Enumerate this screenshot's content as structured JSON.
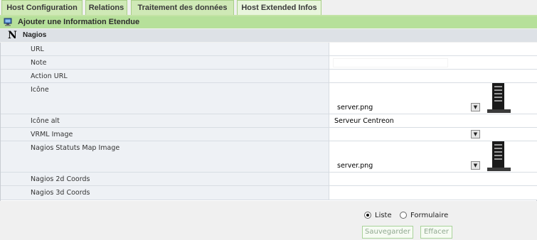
{
  "tabs": [
    {
      "label": "Host Configuration"
    },
    {
      "label": "Relations"
    },
    {
      "label": "Traitement des données"
    },
    {
      "label": "Host Extended Infos"
    }
  ],
  "section": {
    "title": "Ajouter une Information Etendue",
    "icon": "computer-icon"
  },
  "group": {
    "label": "Nagios",
    "icon": "nagios-n-icon"
  },
  "fields": {
    "url": {
      "label": "URL",
      "value": ""
    },
    "note": {
      "label": "Note",
      "value": ""
    },
    "action_url": {
      "label": "Action URL",
      "value": ""
    },
    "icone": {
      "label": "Icône",
      "selected": "server.png",
      "preview_icon": "server-tower-icon"
    },
    "icone_alt": {
      "label": "Icône alt",
      "value": "Serveur Centreon"
    },
    "vrml_image": {
      "label": "VRML Image",
      "selected": ""
    },
    "statuts_map_image": {
      "label": "Nagios Statuts Map Image",
      "selected": "server.png",
      "preview_icon": "server-tower-icon"
    },
    "coords_2d": {
      "label": "Nagios 2d Coords",
      "value": ""
    },
    "coords_3d": {
      "label": "Nagios 3d Coords",
      "value": ""
    }
  },
  "footer": {
    "radio_liste": "Liste",
    "radio_formulaire": "Formulaire",
    "selected_radio": "Liste",
    "save_label": "Sauvegarder",
    "reset_label": "Effacer"
  }
}
